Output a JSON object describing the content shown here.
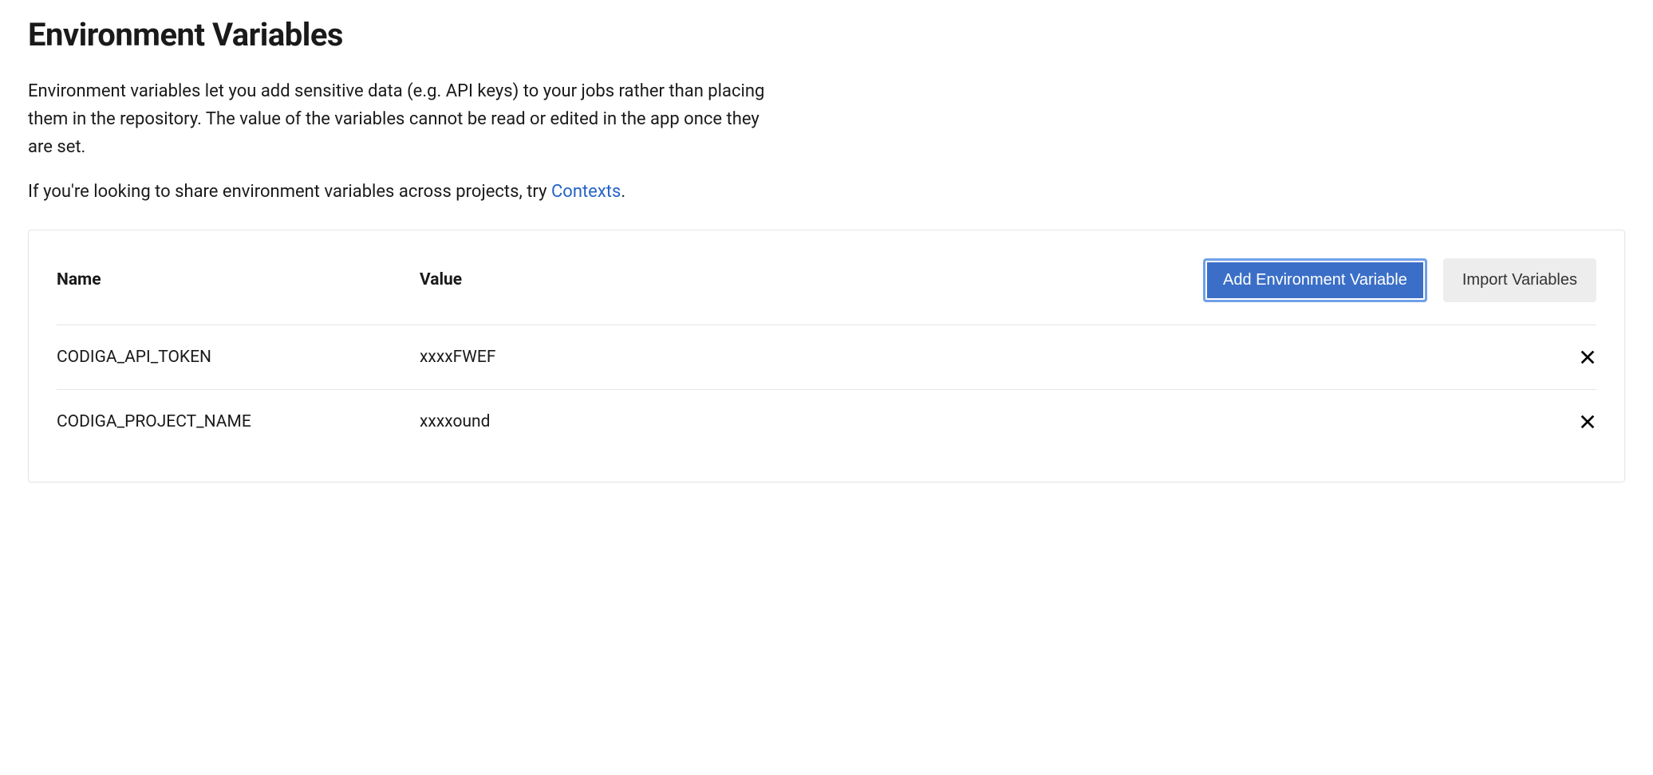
{
  "page": {
    "title": "Environment Variables",
    "description": "Environment variables let you add sensitive data (e.g. API keys) to your jobs rather than placing them in the repository. The value of the variables cannot be read or edited in the app once they are set.",
    "share_prefix": "If you're looking to share environment variables across projects, try ",
    "share_link_label": "Contexts",
    "share_suffix": "."
  },
  "table": {
    "header_name": "Name",
    "header_value": "Value",
    "add_button": "Add Environment Variable",
    "import_button": "Import Variables",
    "rows": [
      {
        "name": "CODIGA_API_TOKEN",
        "value": "xxxxFWEF"
      },
      {
        "name": "CODIGA_PROJECT_NAME",
        "value": "xxxxound"
      }
    ]
  }
}
